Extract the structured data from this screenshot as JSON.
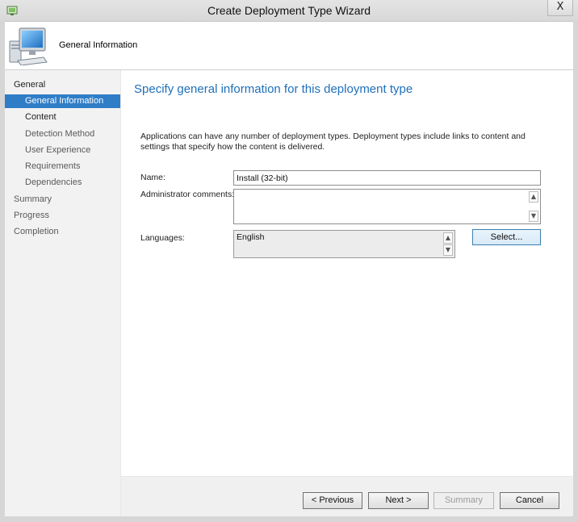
{
  "window": {
    "title": "Create Deployment Type Wizard",
    "close_glyph": "X"
  },
  "header": {
    "title": "General Information",
    "icon": "computer-icon"
  },
  "nav": {
    "items": [
      {
        "label": "General",
        "level": 0,
        "state": "done"
      },
      {
        "label": "General Information",
        "level": 1,
        "state": "selected"
      },
      {
        "label": "Content",
        "level": 1,
        "state": "next"
      },
      {
        "label": "Detection Method",
        "level": 1,
        "state": "pending"
      },
      {
        "label": "User Experience",
        "level": 1,
        "state": "pending"
      },
      {
        "label": "Requirements",
        "level": 1,
        "state": "pending"
      },
      {
        "label": "Dependencies",
        "level": 1,
        "state": "pending"
      },
      {
        "label": "Summary",
        "level": 0,
        "state": "pending"
      },
      {
        "label": "Progress",
        "level": 0,
        "state": "pending"
      },
      {
        "label": "Completion",
        "level": 0,
        "state": "pending"
      }
    ]
  },
  "main": {
    "heading": "Specify general information for this deployment type",
    "description": "Applications can have any number of deployment types. Deployment types include links to content and settings that specify how the content is delivered.",
    "name_label": "Name:",
    "name_value": "Install (32-bit)",
    "comments_label": "Administrator comments:",
    "comments_value": "",
    "languages_label": "Languages:",
    "languages_value": "English",
    "select_button": "Select..."
  },
  "footer": {
    "previous": "< Previous",
    "next": "Next >",
    "summary": "Summary",
    "cancel": "Cancel"
  },
  "colors": {
    "accent": "#2f7dc7",
    "heading": "#1f6fba"
  }
}
